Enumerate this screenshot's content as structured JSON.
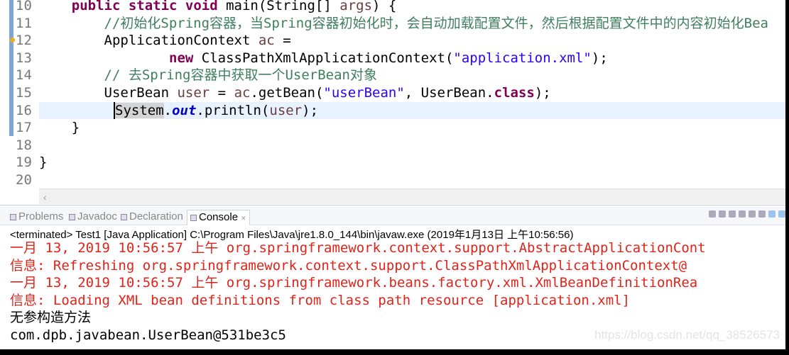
{
  "editor": {
    "lines": [
      {
        "n": "10",
        "parts": [
          {
            "t": "    ",
            "c": ""
          },
          {
            "t": "public static void",
            "c": "kw"
          },
          {
            "t": " main(String[] ",
            "c": ""
          },
          {
            "t": "args",
            "c": "var"
          },
          {
            "t": ") {",
            "c": ""
          }
        ]
      },
      {
        "n": "11",
        "parts": [
          {
            "t": "        //初始化Spring容器，当Spring容器初始化时，会自动加载配置文件，然后根据配置文件中的内容初始化Bea",
            "c": "cm"
          }
        ]
      },
      {
        "n": "12",
        "parts": [
          {
            "t": "        ApplicationContext ",
            "c": ""
          },
          {
            "t": "ac",
            "c": "var"
          },
          {
            "t": " =",
            "c": ""
          }
        ]
      },
      {
        "n": "13",
        "parts": [
          {
            "t": "                ",
            "c": ""
          },
          {
            "t": "new",
            "c": "kw"
          },
          {
            "t": " ClassPathXmlApplicationContext(",
            "c": ""
          },
          {
            "t": "\"application.xml\"",
            "c": "str"
          },
          {
            "t": ");",
            "c": ""
          }
        ]
      },
      {
        "n": "14",
        "parts": [
          {
            "t": "        // 去Spring容器中获取一个UserBean对象",
            "c": "cm"
          }
        ]
      },
      {
        "n": "15",
        "parts": [
          {
            "t": "        UserBean ",
            "c": ""
          },
          {
            "t": "user",
            "c": "var"
          },
          {
            "t": " = ",
            "c": ""
          },
          {
            "t": "ac",
            "c": "var"
          },
          {
            "t": ".getBean(",
            "c": ""
          },
          {
            "t": "\"userBean\"",
            "c": "str"
          },
          {
            "t": ", UserBean.",
            "c": ""
          },
          {
            "t": "class",
            "c": "kw"
          },
          {
            "t": ");",
            "c": ""
          }
        ]
      },
      {
        "n": "16",
        "parts": [
          {
            "t": "System",
            "c": "hl"
          },
          {
            "t": ".",
            "c": ""
          },
          {
            "t": "out",
            "c": "fld"
          },
          {
            "t": ".println(",
            "c": ""
          },
          {
            "t": "user",
            "c": "var"
          },
          {
            "t": ");",
            "c": ""
          }
        ]
      },
      {
        "n": "17",
        "parts": [
          {
            "t": "    }",
            "c": ""
          }
        ]
      },
      {
        "n": "18",
        "parts": []
      },
      {
        "n": "19",
        "parts": [
          {
            "t": "}",
            "c": ""
          }
        ]
      },
      {
        "n": "20",
        "parts": []
      }
    ],
    "scroll_left": "‹"
  },
  "tabs": [
    {
      "label": "Problems",
      "icon": "problems-icon"
    },
    {
      "label": "Javadoc",
      "icon": "javadoc-icon"
    },
    {
      "label": "Declaration",
      "icon": "declaration-icon"
    },
    {
      "label": "Console",
      "icon": "console-icon",
      "active": true,
      "close": "✕"
    }
  ],
  "console": {
    "process": "<terminated> Test1 [Java Application] C:\\Program Files\\Java\\jre1.8.0_144\\bin\\javaw.exe (2019年1月13日 上午10:56:56)",
    "lines": [
      {
        "t": "一月 13, 2019 10:56:57 上午 org.springframework.context.support.AbstractApplicationCont",
        "c": "red"
      },
      {
        "t": "信息: Refreshing org.springframework.context.support.ClassPathXmlApplicationContext@",
        "c": "red"
      },
      {
        "t": "一月 13, 2019 10:56:57 上午 org.springframework.beans.factory.xml.XmlBeanDefinitionRea",
        "c": "red"
      },
      {
        "t": "信息: Loading XML bean definitions from class path resource [application.xml]",
        "c": "red"
      },
      {
        "t": "无参构造方法",
        "c": "blk"
      },
      {
        "t": "com.dpb.javabean.UserBean@531be3c5",
        "c": "blk"
      }
    ]
  },
  "watermark": "https://blog.csdn.net/qq_38526573"
}
